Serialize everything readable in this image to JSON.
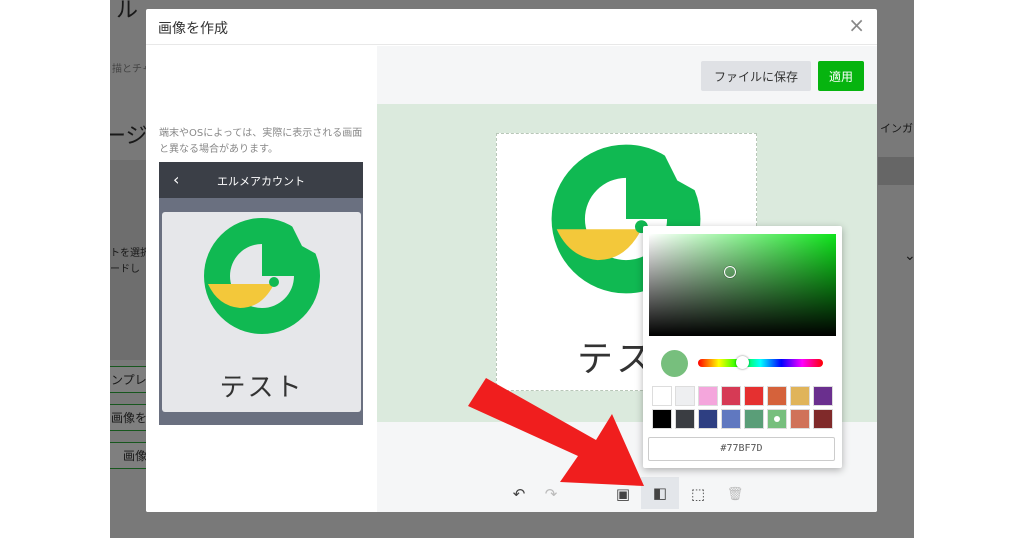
{
  "background": {
    "partial_title": "ル",
    "partial_desc": "描とチャ",
    "partial_heading": "ージ",
    "partial_select_text_1": "トを選択",
    "partial_select_text_2": "ードし",
    "partial_template_btn": "ンプレ",
    "partial_image_btn": "画像をフ",
    "partial_image_btn2": "画像",
    "partial_right_label": "インガー",
    "partial_right_chevron": "⌄"
  },
  "modal": {
    "title": "画像を作成",
    "close_glyph": "×",
    "note": "端末やOSによっては、実際に表示される画面と異なる場合があります。",
    "preview": {
      "back_glyph": "‹",
      "account_name": "エルメアカウント",
      "caption": "テスト"
    },
    "buttons": {
      "save_file": "ファイルに保存",
      "apply": "適用"
    },
    "canvas_caption": "テスト",
    "tools": {
      "undo_glyph": "↶",
      "redo_glyph": "↷",
      "image_glyph": "▣",
      "fill_glyph": "◧",
      "border_glyph": "⬚",
      "delete_glyph": "🗑"
    }
  },
  "color_picker": {
    "hex_value": "#77BF7D",
    "preview_color": "#77BF7D",
    "hue_position": 0.35,
    "swatches": [
      "#ffffff",
      "#eeeff1",
      "#f4a6dc",
      "#d63a55",
      "#e53030",
      "#d5623b",
      "#e0b45a",
      "#6a2f8e",
      "#000000",
      "#3a3d42",
      "#2e3f82",
      "#6078c0",
      "#5a9e78",
      "#77bf7d",
      "#d07259",
      "#802a2a"
    ],
    "selected_swatch": 13
  },
  "colors": {
    "brand_green": "#06b40f",
    "arrow_red": "#f01e1e",
    "logo_green": "#10b952",
    "logo_yellow": "#f3c83a"
  }
}
